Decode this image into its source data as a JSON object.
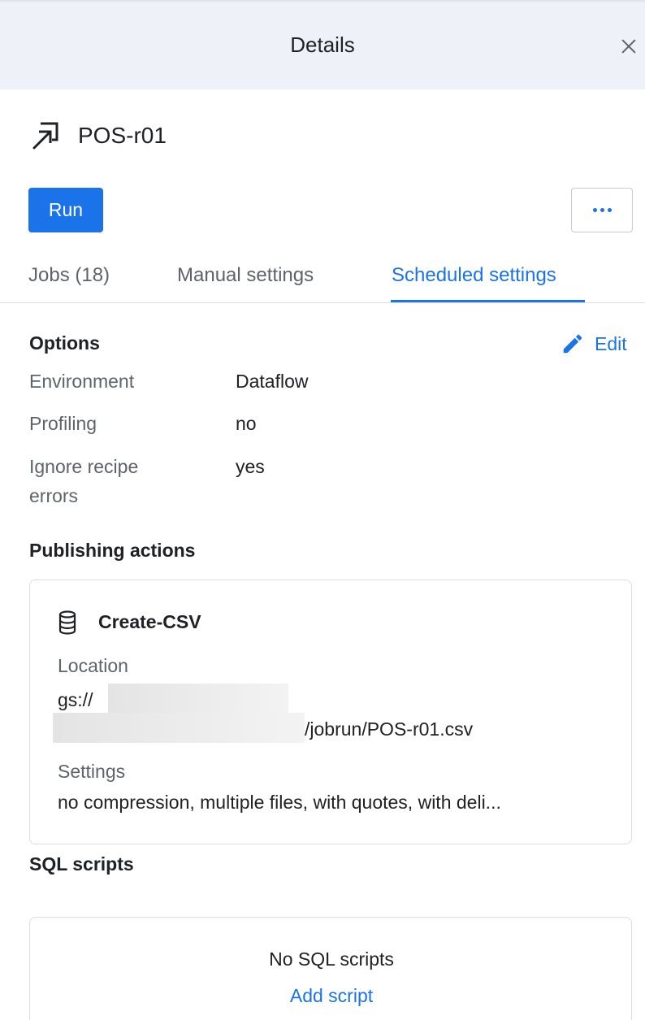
{
  "header": {
    "title": "Details",
    "close_icon": "close-icon"
  },
  "flow": {
    "name": "POS-r01",
    "icon": "output-arrow-icon"
  },
  "actions": {
    "run_label": "Run",
    "more_icon": "more-horizontal-icon"
  },
  "tabs": [
    {
      "label": "Jobs (18)",
      "active": false
    },
    {
      "label": "Manual settings",
      "active": false
    },
    {
      "label": "Scheduled settings",
      "active": true
    }
  ],
  "options": {
    "title": "Options",
    "edit_label": "Edit",
    "rows": [
      {
        "label": "Environment",
        "value": "Dataflow"
      },
      {
        "label": "Profiling",
        "value": "no"
      },
      {
        "label_line1": "Ignore recipe",
        "label_line2": "errors",
        "value": "yes"
      }
    ]
  },
  "publishing": {
    "title": "Publishing actions",
    "action": {
      "icon": "database-icon",
      "name": "Create-CSV",
      "location_label": "Location",
      "location_prefix": "gs://",
      "location_suffix": "/jobrun/POS-r01.csv",
      "settings_label": "Settings",
      "settings_value": "no compression, multiple files, with quotes, with deli..."
    }
  },
  "sql": {
    "title": "SQL scripts",
    "empty_text": "No SQL scripts",
    "add_label": "Add script"
  },
  "colors": {
    "accent": "#1a73e8",
    "header_bg": "#eef2f8",
    "muted_text": "#5f6368"
  }
}
